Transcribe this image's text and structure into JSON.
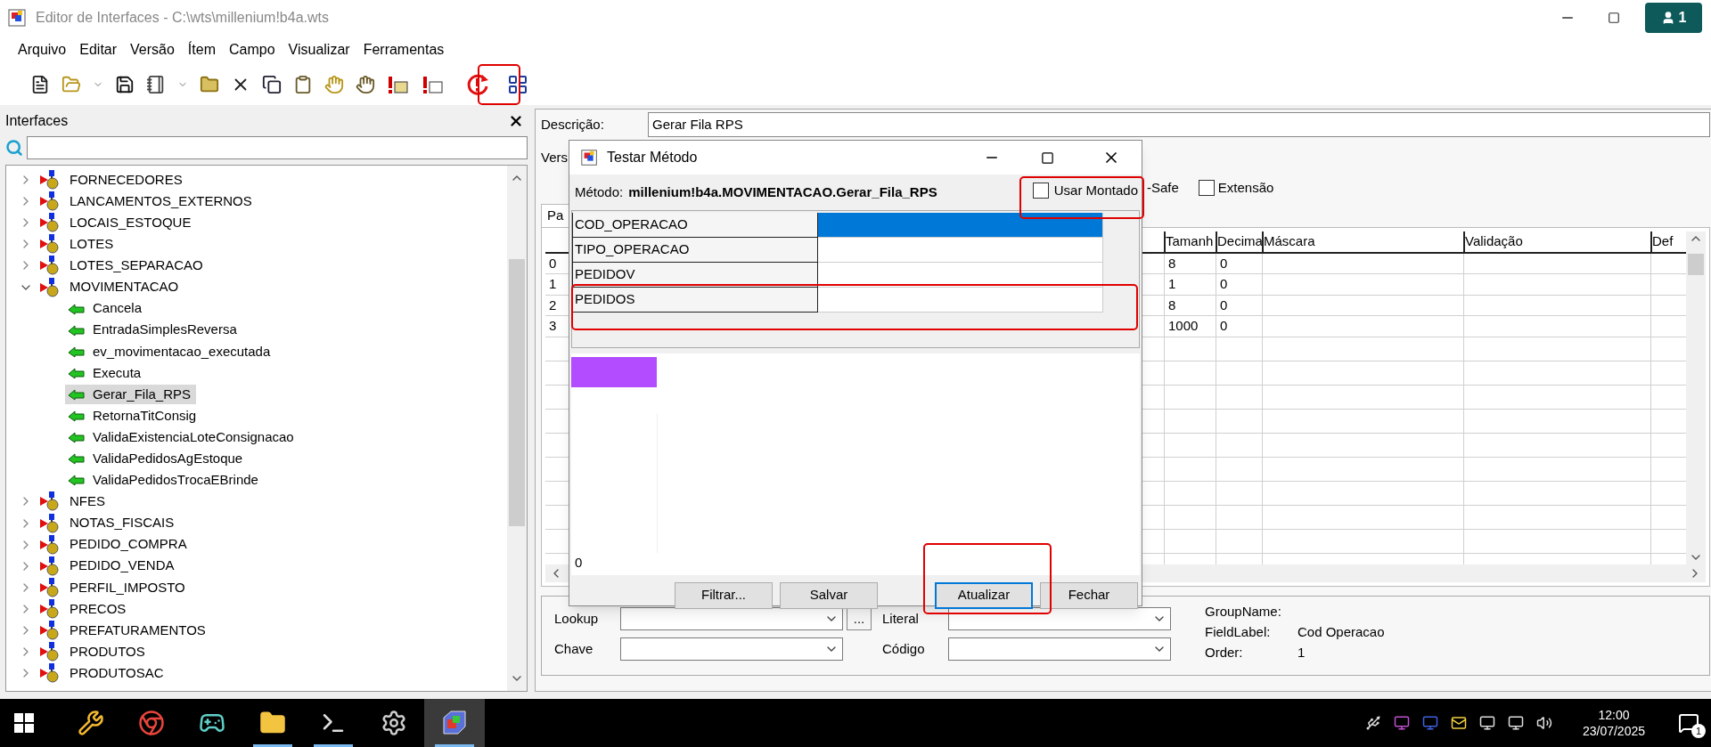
{
  "window": {
    "title": "Editor de Interfaces - C:\\wts\\millenium!b4a.wts",
    "user_badge": "1"
  },
  "menu": [
    "Arquivo",
    "Editar",
    "Versão",
    "Ítem",
    "Campo",
    "Visualizar",
    "Ferramentas"
  ],
  "sidebar": {
    "title": "Interfaces",
    "items": [
      {
        "label": "FORNECEDORES",
        "expanded": false,
        "selected": false
      },
      {
        "label": "LANCAMENTOS_EXTERNOS",
        "expanded": false,
        "selected": false
      },
      {
        "label": "LOCAIS_ESTOQUE",
        "expanded": false,
        "selected": false
      },
      {
        "label": "LOTES",
        "expanded": false,
        "selected": false
      },
      {
        "label": "LOTES_SEPARACAO",
        "expanded": false,
        "selected": false
      },
      {
        "label": "MOVIMENTACAO",
        "expanded": true,
        "selected": false,
        "children": [
          {
            "label": "Cancela",
            "selected": false
          },
          {
            "label": "EntradaSimplesReversa",
            "selected": false
          },
          {
            "label": "ev_movimentacao_executada",
            "selected": false
          },
          {
            "label": "Executa",
            "selected": false
          },
          {
            "label": "Gerar_Fila_RPS",
            "selected": true
          },
          {
            "label": "RetornaTitConsig",
            "selected": false
          },
          {
            "label": "ValidaExistenciaLoteConsignacao",
            "selected": false
          },
          {
            "label": "ValidaPedidosAgEstoque",
            "selected": false
          },
          {
            "label": "ValidaPedidosTrocaEBrinde",
            "selected": false
          }
        ]
      },
      {
        "label": "NFES",
        "expanded": false,
        "selected": false
      },
      {
        "label": "NOTAS_FISCAIS",
        "expanded": false,
        "selected": false
      },
      {
        "label": "PEDIDO_COMPRA",
        "expanded": false,
        "selected": false
      },
      {
        "label": "PEDIDO_VENDA",
        "expanded": false,
        "selected": false
      },
      {
        "label": "PERFIL_IMPOSTO",
        "expanded": false,
        "selected": false
      },
      {
        "label": "PRECOS",
        "expanded": false,
        "selected": false
      },
      {
        "label": "PREFATURAMENTOS",
        "expanded": false,
        "selected": false
      },
      {
        "label": "PRODUTOS",
        "expanded": false,
        "selected": false
      },
      {
        "label": "PRODUTOSAC",
        "expanded": false,
        "selected": false
      }
    ]
  },
  "detail": {
    "description_label": "Descrição:",
    "description_value": "Gerar Fila RPS",
    "version_label": "Vers",
    "safe_label": "-Safe",
    "extension": {
      "label": "Extensão",
      "checked": false
    },
    "tab_label": "Pa",
    "table": {
      "columns": [
        "Tamanh",
        "Decima",
        "Máscara",
        "Validação",
        "Def"
      ],
      "rows": [
        {
          "index": "0",
          "cells": [
            "8",
            "0"
          ]
        },
        {
          "index": "1",
          "cells": [
            "1",
            "0"
          ]
        },
        {
          "index": "2",
          "cells": [
            "8",
            "0"
          ]
        },
        {
          "index": "3",
          "cells": [
            "1000",
            "0"
          ]
        }
      ]
    }
  },
  "dialog": {
    "title": "Testar Método",
    "method_label": "Método:",
    "method_value": "millenium!b4a.MOVIMENTACAO.Gerar_Fila_RPS",
    "use_assembled": {
      "label": "Usar Montado",
      "checked": false
    },
    "params": [
      {
        "name": "COD_OPERACAO",
        "selected": true
      },
      {
        "name": "TIPO_OPERACAO",
        "selected": false
      },
      {
        "name": "PEDIDOV",
        "selected": false
      },
      {
        "name": "PEDIDOS",
        "selected": false
      }
    ],
    "result_count": "0",
    "buttons": [
      {
        "label": "Filtrar...",
        "default": false
      },
      {
        "label": "Salvar",
        "default": false
      },
      {
        "label": "Atualizar",
        "default": true
      },
      {
        "label": "Fechar",
        "default": false
      }
    ]
  },
  "form": {
    "lookup_label": "Lookup",
    "more_button": "...",
    "key_label": "Chave",
    "literal_label": "Literal",
    "code_label": "Código",
    "info": [
      {
        "label": "GroupName:"
      },
      {
        "label": "FieldLabel:",
        "value": "Cod Operacao"
      },
      {
        "label": "Order:",
        "value": "1"
      }
    ]
  },
  "taskbar": {
    "apps": [
      {
        "kind": "tools",
        "running": false,
        "selected": false
      },
      {
        "kind": "browser",
        "running": false,
        "selected": false
      },
      {
        "kind": "game",
        "running": false,
        "selected": false
      },
      {
        "kind": "folder",
        "running": true,
        "selected": false
      },
      {
        "kind": "terminal",
        "running": true,
        "selected": false
      },
      {
        "kind": "settings",
        "running": false,
        "selected": false
      },
      {
        "kind": "editor",
        "running": true,
        "selected": true
      }
    ],
    "time": "12:00",
    "date": "23/07/2025",
    "notifications": "1"
  }
}
